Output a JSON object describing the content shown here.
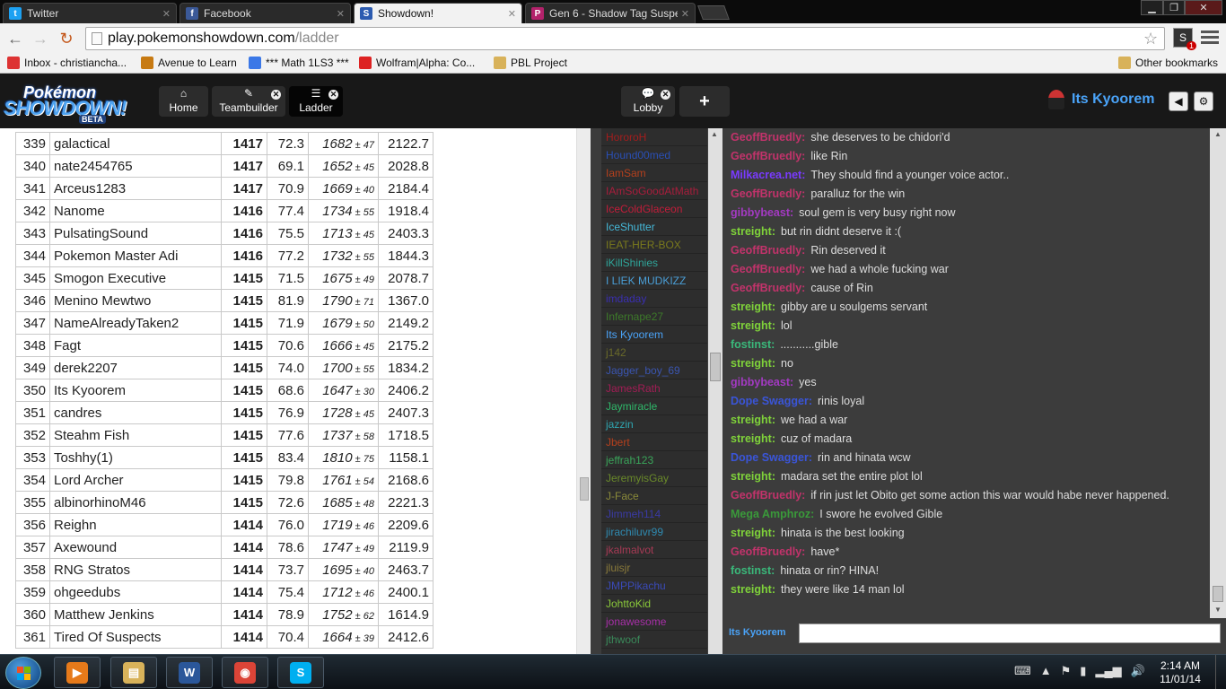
{
  "browser": {
    "tabs": [
      {
        "title": "Twitter",
        "favicon": "twitter-icon",
        "color": "#1da1f2",
        "glyph": "t",
        "active": false
      },
      {
        "title": "Facebook",
        "favicon": "facebook-icon",
        "color": "#3b5998",
        "glyph": "f",
        "active": false
      },
      {
        "title": "Showdown!",
        "favicon": "showdown-icon",
        "color": "#2c5bb0",
        "glyph": "S",
        "active": true
      },
      {
        "title": "Gen 6 - Shadow Tag Suspe",
        "favicon": "pokeball-icon",
        "color": "#b3226b",
        "glyph": "P",
        "active": false
      }
    ],
    "url_domain": "play.pokemonshowdown.com",
    "url_path": "/ladder",
    "extension_badge": "1",
    "bookmarks": [
      {
        "label": "Inbox - christiancha...",
        "icon": "gmail-icon",
        "color": "#d33"
      },
      {
        "label": "Avenue to Learn",
        "icon": "puzzle-icon",
        "color": "#c77a12"
      },
      {
        "label": "*** Math 1LS3 ***",
        "icon": "google-icon",
        "color": "#3b78e7"
      },
      {
        "label": "Wolfram|Alpha: Co...",
        "icon": "wolfram-icon",
        "color": "#d22"
      },
      {
        "label": "PBL Project",
        "icon": "folder-icon",
        "color": "#d8b25a"
      }
    ],
    "other_bookmarks": "Other bookmarks"
  },
  "header": {
    "logo": {
      "line1": "Pokémon",
      "line2": "SHOWDOWN!",
      "badge": "BETA"
    },
    "tabs": [
      {
        "label": "Home",
        "icon": "home-icon",
        "glyph": "⌂",
        "closable": false
      },
      {
        "label": "Teambuilder",
        "icon": "edit-icon",
        "glyph": "✎",
        "closable": true
      },
      {
        "label": "Ladder",
        "icon": "list-icon",
        "glyph": "☰",
        "closable": true
      }
    ],
    "room_tabs": [
      {
        "label": "Lobby",
        "icon": "chat-bubble-icon",
        "glyph": "💬",
        "closable": true
      }
    ],
    "add_glyph": "+",
    "username": "Its Kyoorem"
  },
  "ladder": {
    "rows": [
      [
        "339",
        "galactical",
        "1417",
        "72.3",
        "1682",
        "47",
        "2122.7"
      ],
      [
        "340",
        "nate2454765",
        "1417",
        "69.1",
        "1652",
        "45",
        "2028.8"
      ],
      [
        "341",
        "Arceus1283",
        "1417",
        "70.9",
        "1669",
        "40",
        "2184.4"
      ],
      [
        "342",
        "Nanome",
        "1416",
        "77.4",
        "1734",
        "55",
        "1918.4"
      ],
      [
        "343",
        "PulsatingSound",
        "1416",
        "75.5",
        "1713",
        "45",
        "2403.3"
      ],
      [
        "344",
        "Pokemon Master Adi",
        "1416",
        "77.2",
        "1732",
        "55",
        "1844.3"
      ],
      [
        "345",
        "Smogon Executive",
        "1415",
        "71.5",
        "1675",
        "49",
        "2078.7"
      ],
      [
        "346",
        "Menino Mewtwo",
        "1415",
        "81.9",
        "1790",
        "71",
        "1367.0"
      ],
      [
        "347",
        "NameAlreadyTaken2",
        "1415",
        "71.9",
        "1679",
        "50",
        "2149.2"
      ],
      [
        "348",
        "Fagt",
        "1415",
        "70.6",
        "1666",
        "45",
        "2175.2"
      ],
      [
        "349",
        "derek2207",
        "1415",
        "74.0",
        "1700",
        "55",
        "1834.2"
      ],
      [
        "350",
        "Its Kyoorem",
        "1415",
        "68.6",
        "1647",
        "30",
        "2406.2"
      ],
      [
        "351",
        "candres",
        "1415",
        "76.9",
        "1728",
        "45",
        "2407.3"
      ],
      [
        "352",
        "Steahm Fish",
        "1415",
        "77.6",
        "1737",
        "58",
        "1718.5"
      ],
      [
        "353",
        "Toshhy(1)",
        "1415",
        "83.4",
        "1810",
        "75",
        "1158.1"
      ],
      [
        "354",
        "Lord Archer",
        "1415",
        "79.8",
        "1761",
        "54",
        "2168.6"
      ],
      [
        "355",
        "albinorhinoM46",
        "1415",
        "72.6",
        "1685",
        "48",
        "2221.3"
      ],
      [
        "356",
        "Reighn",
        "1414",
        "76.0",
        "1719",
        "46",
        "2209.6"
      ],
      [
        "357",
        "Axewound",
        "1414",
        "78.6",
        "1747",
        "49",
        "2119.9"
      ],
      [
        "358",
        "RNG Stratos",
        "1414",
        "73.7",
        "1695",
        "40",
        "2463.7"
      ],
      [
        "359",
        "ohgeedubs",
        "1414",
        "75.4",
        "1712",
        "46",
        "2400.1"
      ],
      [
        "360",
        "Matthew Jenkins",
        "1414",
        "78.9",
        "1752",
        "62",
        "1614.9"
      ],
      [
        "361",
        "Tired Of Suspects",
        "1414",
        "70.4",
        "1664",
        "39",
        "2412.6"
      ]
    ],
    "pm": "±"
  },
  "userlist": [
    {
      "name": "HororoH",
      "color": "#a31d1d"
    },
    {
      "name": "Hound00med",
      "color": "#2a4fb5"
    },
    {
      "name": "IamSam",
      "color": "#b5401d"
    },
    {
      "name": "IAmSoGoodAtMath",
      "color": "#a81d3c"
    },
    {
      "name": "IceColdGlaceon",
      "color": "#c21d3a"
    },
    {
      "name": "IceShutter",
      "color": "#45b8d8"
    },
    {
      "name": "IEAT-HER-BOX",
      "color": "#7a7a1d"
    },
    {
      "name": "iKillShinies",
      "color": "#2fa59a"
    },
    {
      "name": "I LIEK MUDKIZZ",
      "color": "#4a9fd8"
    },
    {
      "name": "imdaday",
      "color": "#3a2fb0"
    },
    {
      "name": "Infernape27",
      "color": "#3d7a2a"
    },
    {
      "name": "Its Kyoorem",
      "color": "#4aa3f8"
    },
    {
      "name": "j142",
      "color": "#6a6a2a"
    },
    {
      "name": "Jagger_boy_69",
      "color": "#3a55b0"
    },
    {
      "name": "JamesRath",
      "color": "#a31d55"
    },
    {
      "name": "Jaymiracle",
      "color": "#2fb86a"
    },
    {
      "name": "jazzin",
      "color": "#2fa5b0"
    },
    {
      "name": "Jbert",
      "color": "#b5401d"
    },
    {
      "name": "jeffrah123",
      "color": "#3aa55a"
    },
    {
      "name": "JeremyisGay",
      "color": "#6a8a2a"
    },
    {
      "name": "J-Face",
      "color": "#8a8a3a"
    },
    {
      "name": "Jimmeh114",
      "color": "#3a3aa5"
    },
    {
      "name": "jirachiluvr99",
      "color": "#2f8ab0"
    },
    {
      "name": "jkalmalvot",
      "color": "#a83a55"
    },
    {
      "name": "jluisjr",
      "color": "#8a7a3a"
    },
    {
      "name": "JMPPikachu",
      "color": "#3a4ab8"
    },
    {
      "name": "JohttoKid",
      "color": "#8ac83a"
    },
    {
      "name": "jonawesome",
      "color": "#a82fa8"
    },
    {
      "name": "jthwoof",
      "color": "#3a8a5a"
    }
  ],
  "chat": [
    {
      "user": "GeoffBruedly:",
      "color": "#c2336b",
      "text": "she deserves to be chidori'd"
    },
    {
      "user": "GeoffBruedly:",
      "color": "#c2336b",
      "text": "like Rin"
    },
    {
      "user": "Milkacrea.net:",
      "color": "#7a3aff",
      "text": "They should find a younger voice actor.."
    },
    {
      "user": "GeoffBruedly:",
      "color": "#c2336b",
      "text": "paralluz for the win"
    },
    {
      "user": "gibbybeast:",
      "color": "#a33ac2",
      "text": "soul gem is very busy right now"
    },
    {
      "user": "streight:",
      "color": "#7fd23a",
      "text": "but rin didnt deserve it :("
    },
    {
      "user": "GeoffBruedly:",
      "color": "#c2336b",
      "text": "Rin deserved it"
    },
    {
      "user": "GeoffBruedly:",
      "color": "#c2336b",
      "text": "we had a whole fucking war"
    },
    {
      "user": "GeoffBruedly:",
      "color": "#c2336b",
      "text": "cause of Rin"
    },
    {
      "user": "streight:",
      "color": "#7fd23a",
      "text": "gibby are u soulgems servant"
    },
    {
      "user": "streight:",
      "color": "#7fd23a",
      "text": "lol"
    },
    {
      "user": "fostinst:",
      "color": "#3ab87a",
      "text": "...........gible"
    },
    {
      "user": "streight:",
      "color": "#7fd23a",
      "text": "no"
    },
    {
      "user": "gibbybeast:",
      "color": "#a33ac2",
      "text": "yes"
    },
    {
      "user": "Dope Swagger:",
      "color": "#3a55d8",
      "text": "rinis loyal"
    },
    {
      "user": "streight:",
      "color": "#7fd23a",
      "text": "we had a war"
    },
    {
      "user": "streight:",
      "color": "#7fd23a",
      "text": "cuz of madara"
    },
    {
      "user": "Dope Swagger:",
      "color": "#3a55d8",
      "text": "rin and hinata wcw"
    },
    {
      "user": "streight:",
      "color": "#7fd23a",
      "text": "madara set the entire plot lol"
    },
    {
      "user": "GeoffBruedly:",
      "color": "#c2336b",
      "text": "if rin just let Obito get some action this war would habe never happened.",
      "wrap": true
    },
    {
      "user": "Mega Amphroz:",
      "color": "#3a9a3a",
      "text": "I swore he evolved Gible"
    },
    {
      "user": "streight:",
      "color": "#7fd23a",
      "text": "hinata is the best looking"
    },
    {
      "user": "GeoffBruedly:",
      "color": "#c2336b",
      "text": "have*"
    },
    {
      "user": "fostinst:",
      "color": "#3ab87a",
      "text": "hinata or rin? HINA!"
    },
    {
      "user": "streight:",
      "color": "#7fd23a",
      "text": "they were like 14 man lol"
    }
  ],
  "chat_input": {
    "username": "Its Kyoorem",
    "value": ""
  },
  "taskbar": {
    "apps": [
      {
        "name": "media-player-icon",
        "color": "#e67a1a",
        "glyph": "▶"
      },
      {
        "name": "explorer-folder-icon",
        "color": "#d8b25a",
        "glyph": "▤"
      },
      {
        "name": "word-icon",
        "color": "#2b579a",
        "glyph": "W"
      },
      {
        "name": "chrome-icon",
        "color": "#db4437",
        "glyph": "◉"
      },
      {
        "name": "skype-icon",
        "color": "#00aff0",
        "glyph": "S"
      }
    ],
    "time": "2:14 AM",
    "date": "11/01/14"
  }
}
